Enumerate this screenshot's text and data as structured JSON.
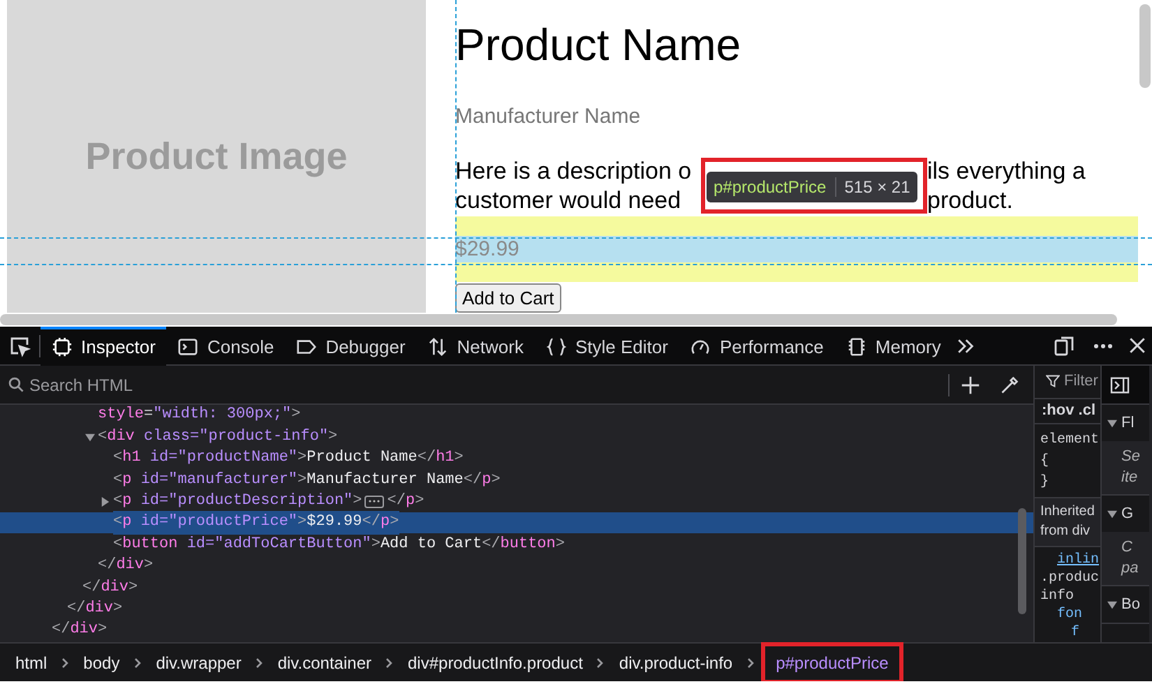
{
  "page": {
    "image_label": "Product Image",
    "product_name": "Product Name",
    "manufacturer": "Manufacturer Name",
    "description_lines": [
      [
        "Here is a description o",
        "ils everything a"
      ],
      [
        "customer would need",
        "product."
      ]
    ],
    "price": "$29.99",
    "button": "Add to Cart"
  },
  "highlight": {
    "selector": "p#productPrice",
    "size": "515 × 21"
  },
  "toolbar": {
    "tabs": [
      {
        "label": "Inspector",
        "kind": "inspector",
        "selected": true
      },
      {
        "label": "Console",
        "kind": "console",
        "selected": false
      },
      {
        "label": "Debugger",
        "kind": "debugger",
        "selected": false
      },
      {
        "label": "Network",
        "kind": "network",
        "selected": false
      },
      {
        "label": "Style Editor",
        "kind": "style",
        "selected": false
      },
      {
        "label": "Performance",
        "kind": "performance",
        "selected": false
      },
      {
        "label": "Memory",
        "kind": "memory",
        "selected": false
      }
    ]
  },
  "search": {
    "placeholder": "Search HTML"
  },
  "markup": [
    {
      "close": "</div>",
      "children": [
        {
          "close": "</div>",
          "children": [
            {
              "close": "</div>",
              "children": [
                {
                  "text": "style=\"width: 300px;\">"
                },
                {
                  "text": "<div class=\"product-info\">",
                  "expanded": true,
                  "close": "</div>",
                  "children": [
                    {
                      "text": "<h1 id=\"productName\">Product Name</h1>"
                    },
                    {
                      "text": "<p id=\"manufacturer\">Manufacturer Name</p>"
                    },
                    {
                      "text": "<p id=\"productDescription\">",
                      "tail": "</p>",
                      "expanded": false
                    },
                    {
                      "text": "<p id=\"productPrice\">$29.99</p>",
                      "selected": true
                    },
                    {
                      "text": "<button id=\"addToCartButton\">Add to Cart</button>"
                    }
                  ]
                }
              ]
            }
          ]
        }
      ]
    }
  ],
  "rules": {
    "filter": "Filter",
    "pseudo": ":hov .cl",
    "lines": [
      "element",
      "{",
      "}"
    ],
    "inherited": [
      "Inherited",
      "from div"
    ],
    "inline": "inlin",
    "selector": ".produc info",
    "props": [
      "fon",
      "f"
    ]
  },
  "side": {
    "sections": [
      {
        "head": "Fl",
        "body": "Se ite"
      },
      {
        "head": "G",
        "body": "C pa"
      },
      {
        "head": "Bo"
      }
    ]
  },
  "breadcrumbs": [
    {
      "label": "html",
      "selected": false
    },
    {
      "label": "body",
      "selected": false
    },
    {
      "label": "div.wrapper",
      "selected": false
    },
    {
      "label": "div.container",
      "selected": false
    },
    {
      "label": "div#productInfo.product",
      "selected": false
    },
    {
      "label": "div.product-info",
      "selected": false
    },
    {
      "label": "p#productPrice",
      "selected": true
    }
  ]
}
